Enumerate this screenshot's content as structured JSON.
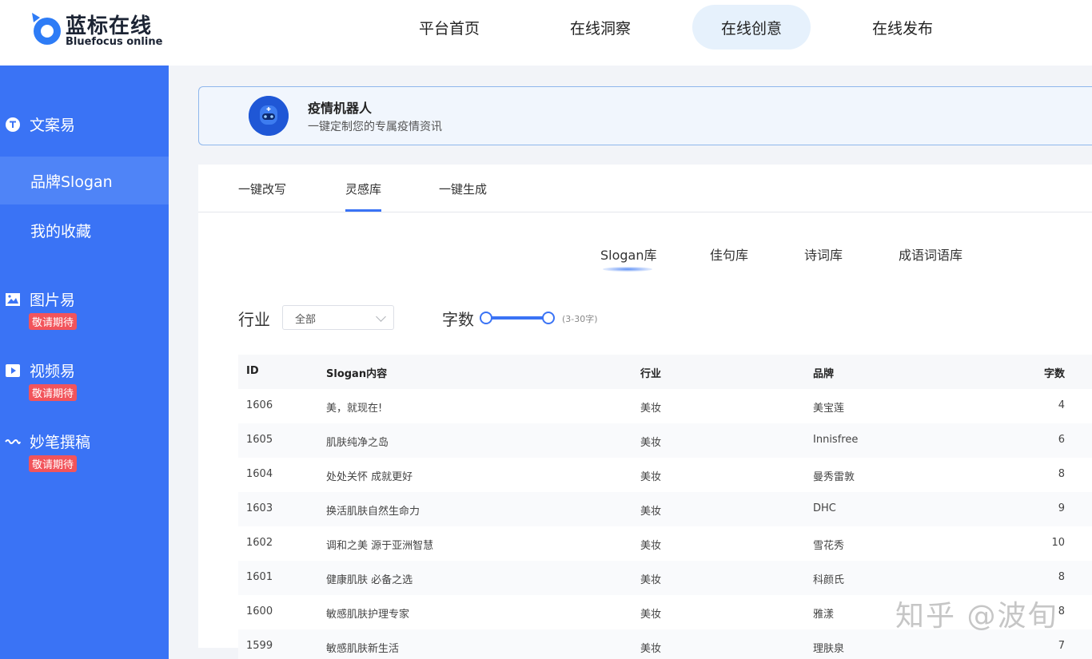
{
  "header": {
    "logo_cn": "蓝标在线",
    "logo_en": "Bluefocus online",
    "nav": [
      {
        "label": "平台首页",
        "active": false
      },
      {
        "label": "在线洞察",
        "active": false
      },
      {
        "label": "在线创意",
        "active": true
      },
      {
        "label": "在线发布",
        "active": false
      }
    ]
  },
  "sidebar": {
    "wenan": {
      "label": "文案易",
      "icon": "t-circle-icon"
    },
    "sub": [
      {
        "label": "品牌Slogan",
        "active": true
      },
      {
        "label": "我的收藏",
        "active": false
      }
    ],
    "tupian": {
      "label": "图片易",
      "badge": "敬请期待",
      "icon": "image-icon"
    },
    "shipin": {
      "label": "视频易",
      "badge": "敬请期待",
      "icon": "play-icon"
    },
    "miaobi": {
      "label": "妙笔撰稿",
      "badge": "敬请期待",
      "icon": "sparkle-icon"
    }
  },
  "banner": {
    "title": "疫情机器人",
    "subtitle": "一键定制您的专属疫情资讯"
  },
  "tabs": [
    {
      "label": "一键改写",
      "active": false
    },
    {
      "label": "灵感库",
      "active": true
    },
    {
      "label": "一键生成",
      "active": false
    }
  ],
  "subtabs": [
    {
      "label": "Slogan库",
      "active": true
    },
    {
      "label": "佳句库",
      "active": false
    },
    {
      "label": "诗词库",
      "active": false
    },
    {
      "label": "成语词语库",
      "active": false
    }
  ],
  "filters": {
    "industry_label": "行业",
    "industry_value": "全部",
    "wordcount_label": "字数",
    "wordcount_range": "(3-30字)"
  },
  "table": {
    "headers": [
      "ID",
      "Slogan内容",
      "行业",
      "品牌",
      "字数"
    ],
    "rows": [
      [
        "1606",
        "美，就现在!",
        "美妆",
        "美宝莲",
        "4"
      ],
      [
        "1605",
        "肌肤纯净之岛",
        "美妆",
        "Innisfree",
        "6"
      ],
      [
        "1604",
        "处处关怀 成就更好",
        "美妆",
        "曼秀雷敦",
        "8"
      ],
      [
        "1603",
        "换活肌肤自然生命力",
        "美妆",
        "DHC",
        "9"
      ],
      [
        "1602",
        "调和之美 源于亚洲智慧",
        "美妆",
        "雪花秀",
        "10"
      ],
      [
        "1601",
        "健康肌肤 必备之选",
        "美妆",
        "科颜氏",
        "8"
      ],
      [
        "1600",
        "敏感肌肤护理专家",
        "美妆",
        "雅漾",
        "8"
      ],
      [
        "1599",
        "敏感肌肤新生活",
        "美妆",
        "理肤泉",
        "7"
      ]
    ]
  },
  "watermark": "知乎 @波旬"
}
